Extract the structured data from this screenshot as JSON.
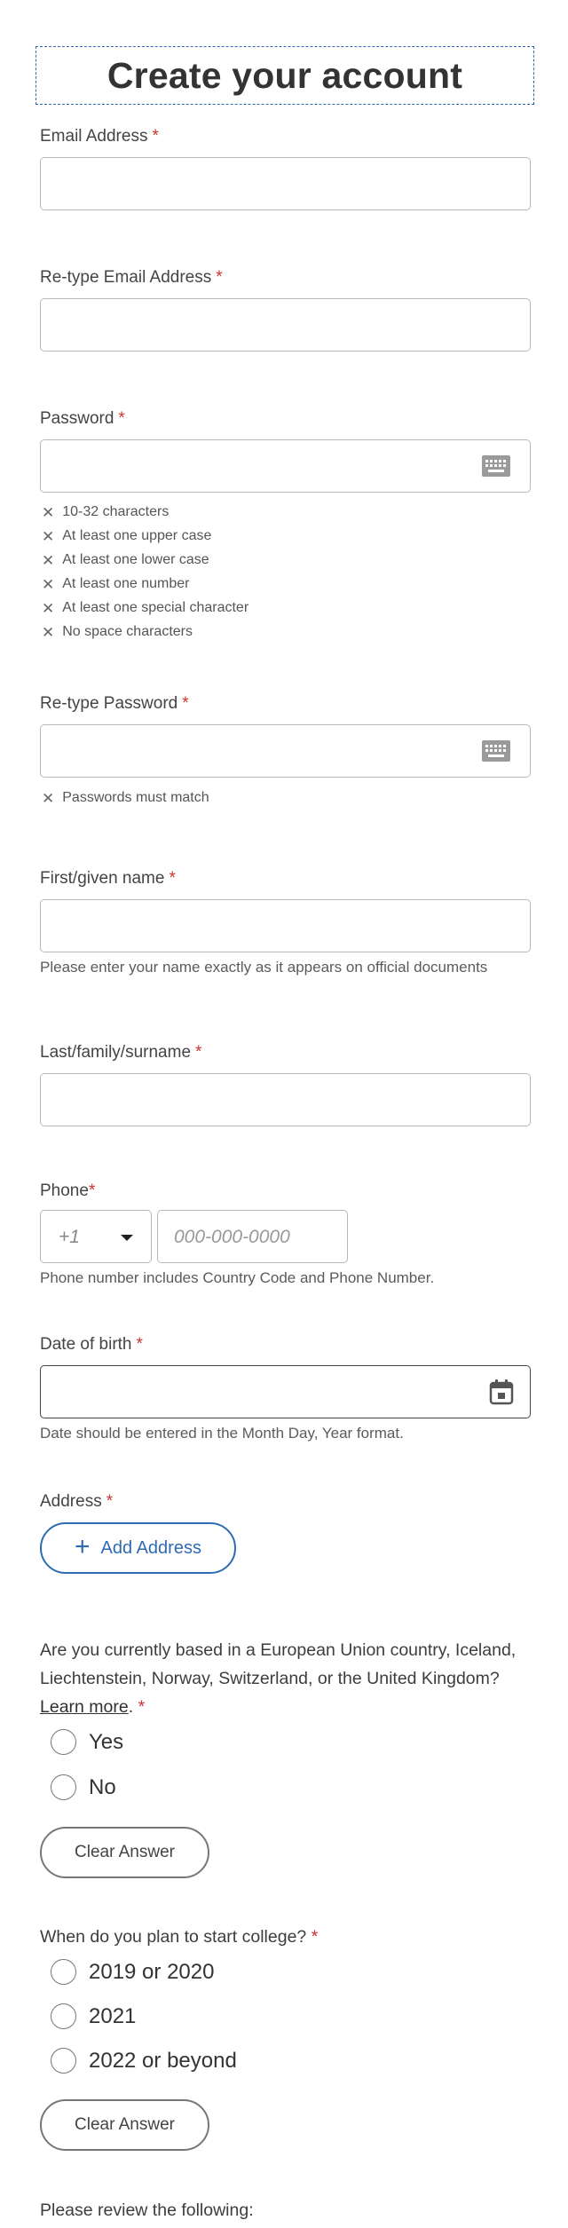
{
  "header": {
    "title": "Create your account"
  },
  "required_marker": "*",
  "email": {
    "label": "Email Address",
    "value": ""
  },
  "retype_email": {
    "label": "Re-type Email Address",
    "value": ""
  },
  "password": {
    "label": "Password",
    "rules": [
      "10-32 characters",
      "At least one upper case",
      "At least one lower case",
      "At least one number",
      "At least one special character",
      "No space characters"
    ],
    "rule_status_icon": "x-mark-icon"
  },
  "retype_password": {
    "label": "Re-type Password",
    "rules": [
      "Passwords must match"
    ]
  },
  "first_name": {
    "label": "First/given name",
    "hint": "Please enter your name exactly as it appears on official documents"
  },
  "last_name": {
    "label": "Last/family/surname"
  },
  "phone": {
    "label": "Phone",
    "country_code": "+1",
    "placeholder": "000-000-0000",
    "hint": "Phone number includes Country Code and Phone Number."
  },
  "dob": {
    "label": "Date of birth",
    "hint": "Date should be entered in the Month Day, Year format."
  },
  "address": {
    "label": "Address",
    "add_button": "Add Address"
  },
  "eu_question": {
    "text": "Are you currently based in a European Union country, Iceland, Liechtenstein, Norway, Switzerland, or the United Kingdom?",
    "link": "Learn more",
    "options": [
      "Yes",
      "No"
    ],
    "clear_label": "Clear Answer"
  },
  "college_question": {
    "text": "When do you plan to start college?",
    "options": [
      "2019 or 2020",
      "2021",
      "2022 or beyond"
    ],
    "clear_label": "Clear Answer"
  },
  "review": {
    "text": "Please review the following:"
  },
  "colors": {
    "accent": "#2f6bb3",
    "required": "#d0322f",
    "border": "#b8b8b8"
  }
}
